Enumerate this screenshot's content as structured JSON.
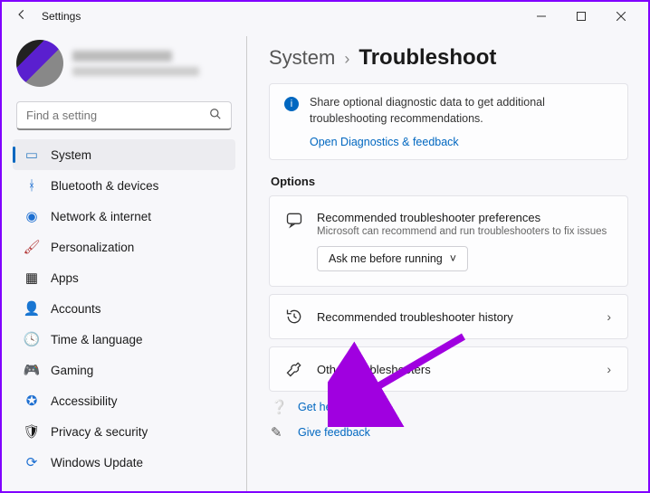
{
  "window": {
    "title": "Settings"
  },
  "search": {
    "placeholder": "Find a setting"
  },
  "sidebar": {
    "items": [
      {
        "label": "System"
      },
      {
        "label": "Bluetooth & devices"
      },
      {
        "label": "Network & internet"
      },
      {
        "label": "Personalization"
      },
      {
        "label": "Apps"
      },
      {
        "label": "Accounts"
      },
      {
        "label": "Time & language"
      },
      {
        "label": "Gaming"
      },
      {
        "label": "Accessibility"
      },
      {
        "label": "Privacy & security"
      },
      {
        "label": "Windows Update"
      }
    ]
  },
  "breadcrumb": {
    "parent": "System",
    "current": "Troubleshoot"
  },
  "info": {
    "message": "Share optional diagnostic data to get additional troubleshooting recommendations.",
    "link": "Open Diagnostics & feedback"
  },
  "options": {
    "heading": "Options",
    "pref": {
      "title": "Recommended troubleshooter preferences",
      "subtitle": "Microsoft can recommend and run troubleshooters to fix issues",
      "dropdown": "Ask me before running"
    },
    "history": {
      "title": "Recommended troubleshooter history"
    },
    "other": {
      "title": "Other troubleshooters"
    }
  },
  "help": {
    "get_help": "Get help",
    "feedback": "Give feedback"
  }
}
